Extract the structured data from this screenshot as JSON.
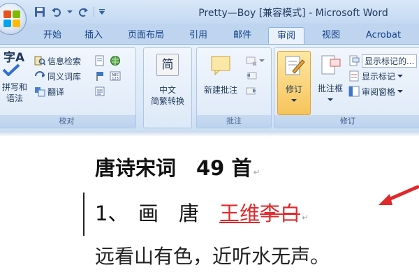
{
  "window": {
    "title": "Pretty—Boy [兼容模式] - Microsoft Word"
  },
  "quick_access": {
    "items": [
      "save-icon",
      "undo-icon",
      "redo-icon",
      "customize-icon"
    ]
  },
  "tabs": [
    {
      "label": "开始",
      "active": false
    },
    {
      "label": "插入",
      "active": false
    },
    {
      "label": "页面布局",
      "active": false
    },
    {
      "label": "引用",
      "active": false
    },
    {
      "label": "邮件",
      "active": false
    },
    {
      "label": "审阅",
      "active": true
    },
    {
      "label": "视图",
      "active": false
    },
    {
      "label": "Acrobat",
      "active": false
    }
  ],
  "ribbon": {
    "proofing": {
      "label": "校对",
      "spelling_label": "拼写和\n语法",
      "spelling_icon_text": "字A",
      "research": "信息检索",
      "thesaurus": "同义词库",
      "translate": "翻译"
    },
    "chinese": {
      "icon_text": "简",
      "label": "中文\n简繁转换"
    },
    "comments": {
      "label": "批注",
      "new_comment": "新建批注"
    },
    "tracking": {
      "label": "修订",
      "track_changes": "修订",
      "balloons": "批注框",
      "show_markup_final": "显示标记的...",
      "show_markup": "显示标记",
      "reviewing_pane": "审阅窗格"
    }
  },
  "document": {
    "line1": "唐诗宋词　49 首",
    "line2_prefix": "1、　画　唐　",
    "inserted_text": "王维",
    "deleted_text": "李白",
    "line3": "远看山有色，近听水无声。",
    "para_mark": "↵"
  },
  "colors": {
    "accent": "#15428b",
    "revision": "#e0292b"
  }
}
